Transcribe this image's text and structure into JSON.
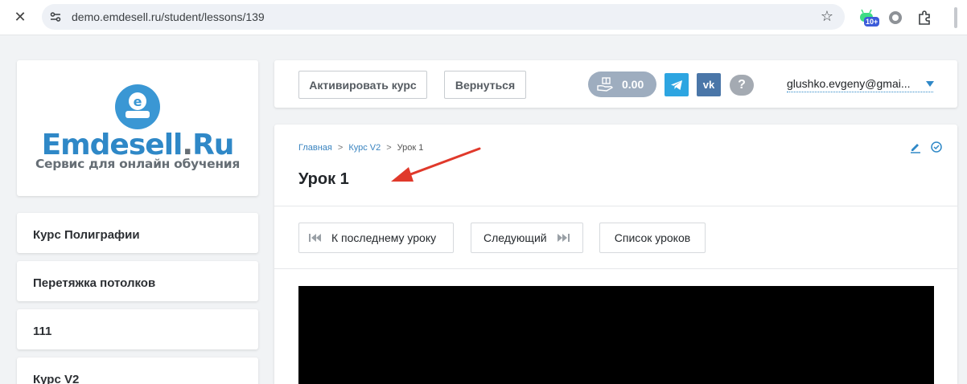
{
  "browser": {
    "url": "demo.emdesell.ru/student/lessons/139",
    "ext_badge": "10+"
  },
  "logo": {
    "letter": "e",
    "name_main": "Emdesell",
    "name_dot": ".",
    "name_tld": "Ru",
    "tagline": "Сервис для онлайн обучения"
  },
  "sidebar": {
    "courses": [
      "Курс Полиграфии",
      "Перетяжка потолков",
      "111",
      "Курс V2"
    ]
  },
  "topbar": {
    "activate_label": "Активировать курс",
    "back_label": "Вернуться",
    "balance": "0.00",
    "vk_label": "vk",
    "help_label": "?",
    "user_email": "glushko.evgeny@gmai..."
  },
  "breadcrumb": {
    "home": "Главная",
    "course": "Курс V2",
    "current": "Урок 1",
    "separator": ">"
  },
  "lesson": {
    "title": "Урок 1",
    "to_last_label": "К последнему уроку",
    "next_label": "Следующий",
    "list_label": "Список уроков"
  },
  "colors": {
    "brand_blue": "#2f88c7",
    "telegram": "#2da5e1",
    "vk": "#4a76a8",
    "annotation_arrow": "#e0392b"
  }
}
